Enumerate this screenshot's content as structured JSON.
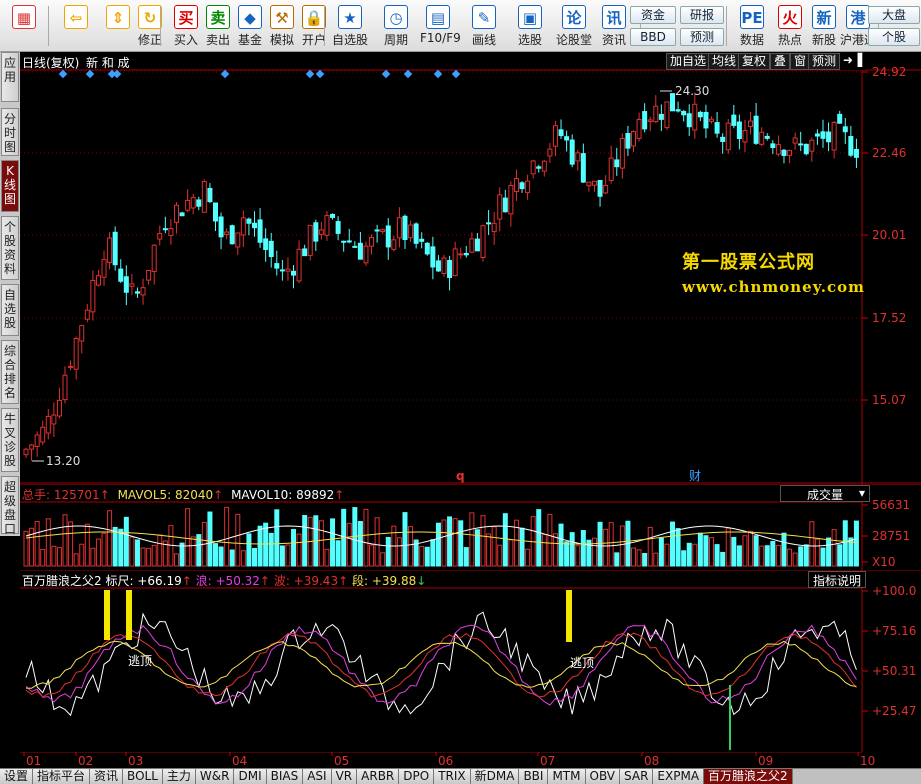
{
  "toolbar": {
    "buttons": [
      {
        "label": "",
        "icon": "windows-grid-icon",
        "color": "#d33"
      },
      {
        "label": "",
        "icon": "back-arrow-icon",
        "color": "#f0a500"
      },
      {
        "label": "",
        "icon": "up-down-arrows-icon",
        "color": "#f0a500"
      },
      {
        "label": "修正",
        "icon": "refresh-icon",
        "color": "#f0a500"
      },
      {
        "label": "买入",
        "icon": "buy-icon",
        "color": "#d00"
      },
      {
        "label": "卖出",
        "icon": "sell-icon",
        "color": "#080"
      },
      {
        "label": "基金",
        "icon": "fund-icon",
        "color": "#1565c0"
      },
      {
        "label": "模拟",
        "icon": "hammer-icon",
        "color": "#b86b00"
      },
      {
        "label": "开户",
        "icon": "lock-icon",
        "color": "#b86b00"
      },
      {
        "label": "自选股",
        "icon": "star-folder-icon",
        "color": "#1565c0"
      },
      {
        "label": "周期",
        "icon": "clock-icon",
        "color": "#1565c0"
      },
      {
        "label": "F10/F9",
        "icon": "window-icon",
        "color": "#1565c0"
      },
      {
        "label": "画线",
        "icon": "pencil-icon",
        "color": "#1565c0"
      },
      {
        "label": "选股",
        "icon": "screen-icon",
        "color": "#1565c0"
      },
      {
        "label": "论股堂",
        "icon": "discuss-icon",
        "color": "#1565c0"
      },
      {
        "label": "资讯",
        "icon": "news-icon",
        "color": "#1565c0"
      },
      {
        "label": "数据",
        "icon": "pe-icon",
        "color": "#1565c0"
      },
      {
        "label": "热点",
        "icon": "hot-icon",
        "color": "#d00"
      },
      {
        "label": "新股",
        "icon": "newstock-icon",
        "color": "#1565c0"
      },
      {
        "label": "沪港通",
        "icon": "hk-icon",
        "color": "#1565c0"
      }
    ],
    "small": {
      "zijin": "资金",
      "bbd": "BBD",
      "yanbao": "研报",
      "yuce": "预测",
      "dapan": "大盘",
      "geguan": "个股"
    }
  },
  "sidetabs": [
    {
      "label": "应用",
      "active": false
    },
    {
      "label": "分时图",
      "active": false
    },
    {
      "label": "K线图",
      "active": true
    },
    {
      "label": "个股资料",
      "active": false
    },
    {
      "label": "自选股",
      "active": false
    },
    {
      "label": "综合排名",
      "active": false
    },
    {
      "label": "牛叉诊股",
      "active": false
    },
    {
      "label": "超级盘口",
      "active": false
    }
  ],
  "main": {
    "period": "日线(复权)",
    "stock_name": "新 和 成",
    "buttons": [
      "加自选",
      "均线",
      "复权",
      "叠",
      "窗",
      "预测"
    ],
    "price_labels": [
      "24.92",
      "22.46",
      "20.01",
      "17.52",
      "15.07"
    ],
    "high_label": "24.30",
    "low_label": "13.20",
    "markers": [
      "q",
      "财"
    ],
    "watermark_title": "第一股票公式网",
    "watermark_url": "www.chnmoney.com"
  },
  "volume": {
    "title": "总手:",
    "value": "125701",
    "mavol5": "MAVOL5: 82040",
    "mavol10": "MAVOL10: 89892",
    "dropdown": "成交量",
    "labels": [
      "56631",
      "28751",
      "X10"
    ]
  },
  "indicator": {
    "name": "百万腊浪之父2",
    "biaochi": "标尺: +66.19",
    "lang": "浪: +50.32",
    "bo": "波: +39.43",
    "duan": "段: +39.88",
    "explain_button": "指标说明",
    "labels": [
      "+100.0",
      "+75.16",
      "+50.31",
      "+25.47"
    ],
    "escape_label": "逃顶"
  },
  "xaxis": [
    "01",
    "02",
    "03",
    "04",
    "05",
    "06",
    "07",
    "08",
    "09",
    "10"
  ],
  "bottomtabs": [
    "设置",
    "指标平台",
    "资讯",
    "BOLL",
    "主力",
    "W&R",
    "DMI",
    "BIAS",
    "ASI",
    "VR",
    "ARBR",
    "DPO",
    "TRIX",
    "新DMA",
    "BBI",
    "MTM",
    "OBV",
    "SAR",
    "EXPMA",
    "百万腊浪之父2"
  ],
  "colors": {
    "up": "#e03030",
    "down": "#54ffff",
    "accent": "#7a0b0b",
    "gold": "#f5d800"
  }
}
